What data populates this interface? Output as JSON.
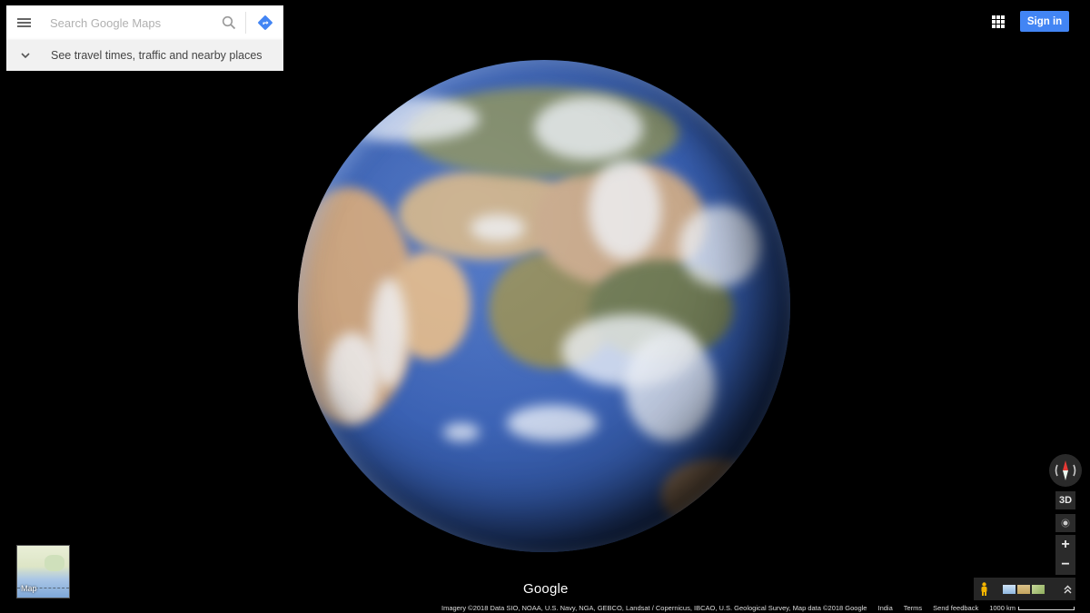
{
  "search": {
    "placeholder": "Search Google Maps",
    "value": ""
  },
  "travel_bar": {
    "label": "See travel times, traffic and nearby places"
  },
  "header": {
    "sign_in_label": "Sign in",
    "accent_color": "#4285f4"
  },
  "controls": {
    "three_d_label": "3D",
    "zoom_in_label": "+",
    "zoom_out_label": "−"
  },
  "minimap": {
    "label": "Map"
  },
  "branding": {
    "logo_text": "Google"
  },
  "footer": {
    "attribution": "Imagery ©2018 Data SIO, NOAA, U.S. Navy, NGA, GEBCO, Landsat / Copernicus, IBCAO, U.S. Geological Survey, Map data ©2018 Google",
    "region": "India",
    "terms": "Terms",
    "feedback": "Send feedback",
    "scale": "1000 km"
  },
  "icons": [
    "menu-icon",
    "search-icon",
    "directions-icon",
    "chevron-down-icon",
    "apps-grid-icon",
    "compass-icon",
    "my-location-icon",
    "pegman-icon",
    "layer-thumbnail-icon",
    "chevron-up-double-icon"
  ]
}
